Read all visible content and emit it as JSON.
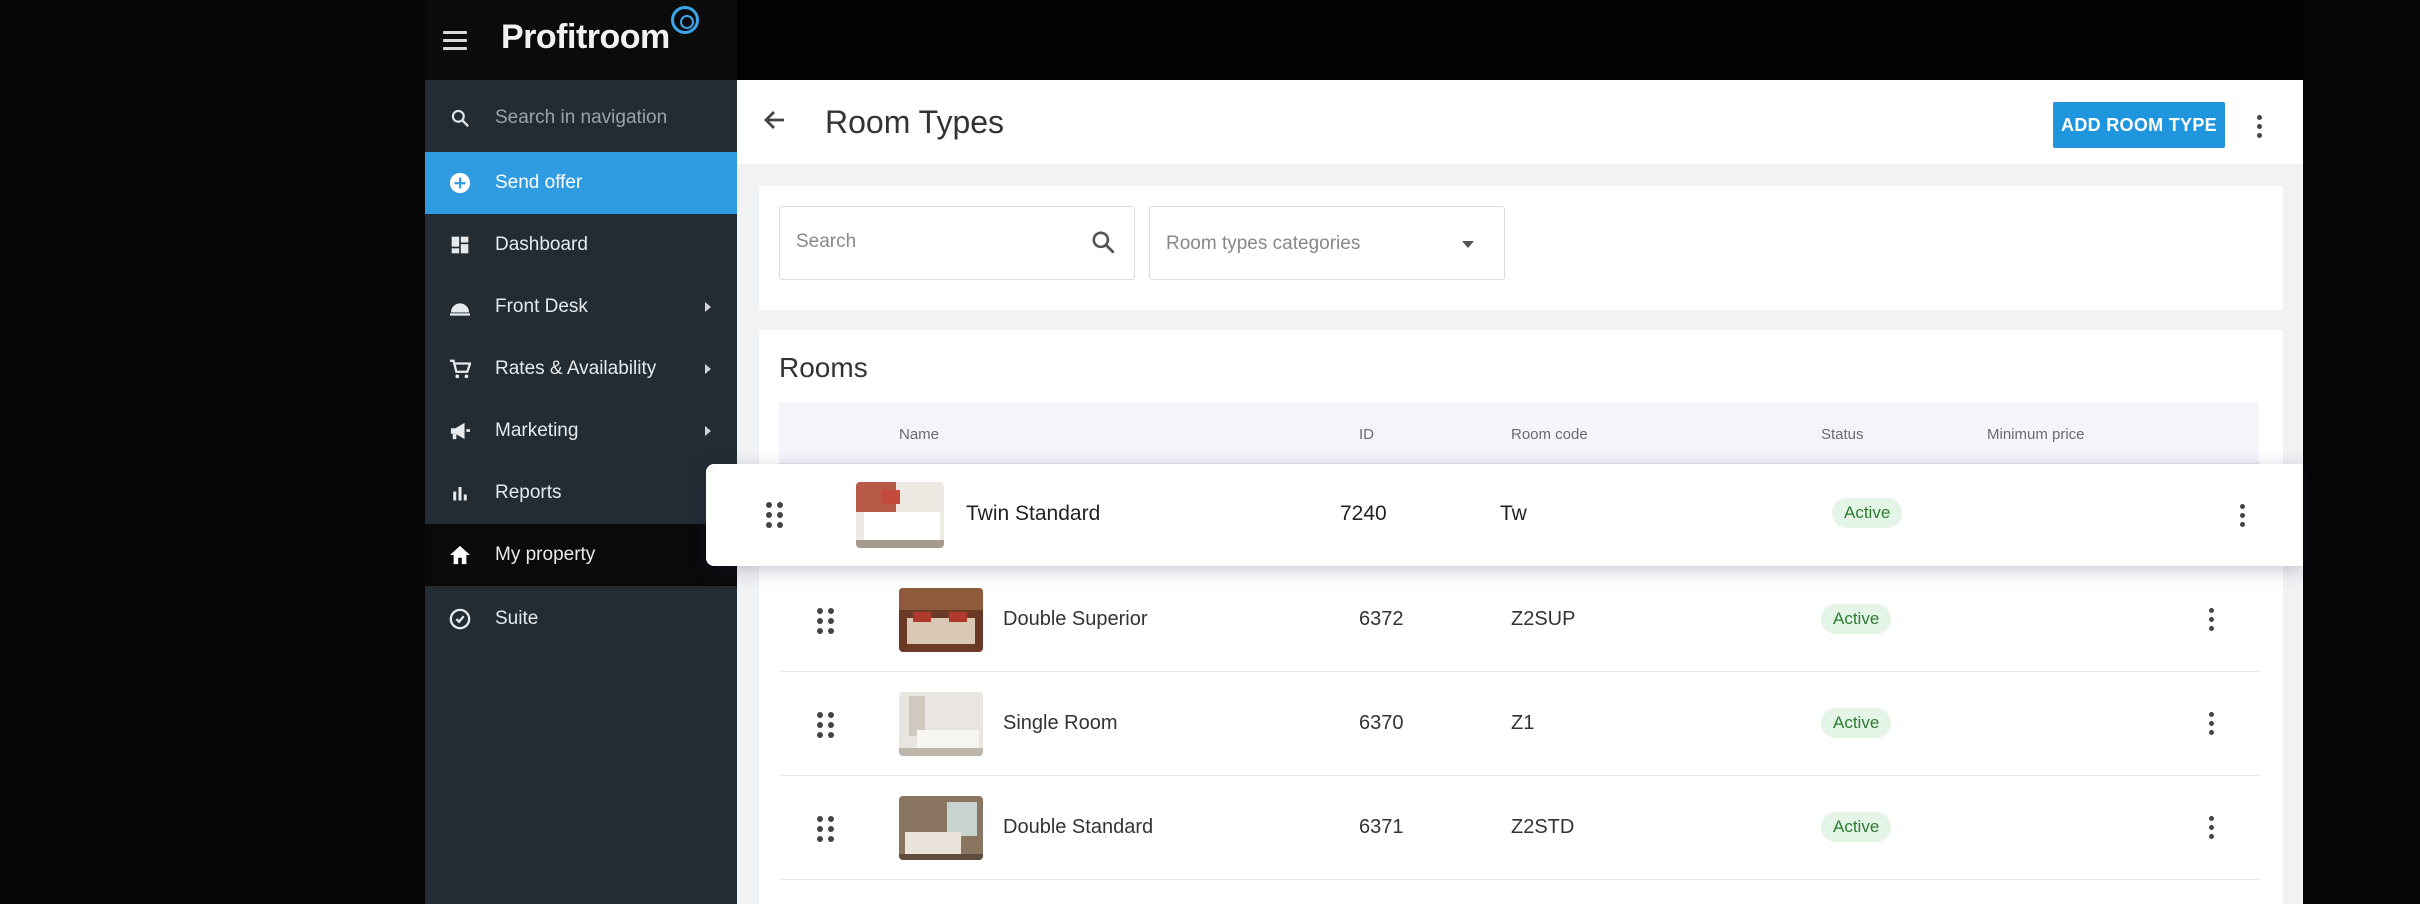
{
  "sidebar": {
    "logo_text": "Profitroom",
    "search_placeholder": "Search in navigation",
    "items": [
      {
        "label": "Send offer",
        "icon": "plus-circle-icon"
      },
      {
        "label": "Dashboard",
        "icon": "dashboard-icon"
      },
      {
        "label": "Front Desk",
        "icon": "bell-icon"
      },
      {
        "label": "Rates & Availability",
        "icon": "cart-icon"
      },
      {
        "label": "Marketing",
        "icon": "megaphone-icon"
      },
      {
        "label": "Reports",
        "icon": "bar-chart-icon"
      },
      {
        "label": "My property",
        "icon": "home-icon"
      },
      {
        "label": "Suite",
        "icon": "suite-icon"
      }
    ]
  },
  "header": {
    "title": "Room Types",
    "add_button": "ADD ROOM TYPE"
  },
  "filters": {
    "search_placeholder": "Search",
    "category_placeholder": "Room types categories"
  },
  "rooms": {
    "title": "Rooms",
    "columns": [
      "Name",
      "ID",
      "Room code",
      "Status",
      "Minimum price"
    ],
    "dragged_row": {
      "name": "Twin Standard",
      "id": "7240",
      "code": "Tw",
      "status": "Active"
    },
    "rows": [
      {
        "name": "Double Superior",
        "id": "6372",
        "code": "Z2SUP",
        "status": "Active"
      },
      {
        "name": "Single Room",
        "id": "6370",
        "code": "Z1",
        "status": "Active"
      },
      {
        "name": "Double Standard",
        "id": "6371",
        "code": "Z2STD",
        "status": "Active"
      }
    ]
  },
  "colors": {
    "accent": "#2f9be0",
    "sidebar": "#232c33",
    "active_badge_bg": "#e4f4e6",
    "active_badge_text": "#2e7d32"
  }
}
